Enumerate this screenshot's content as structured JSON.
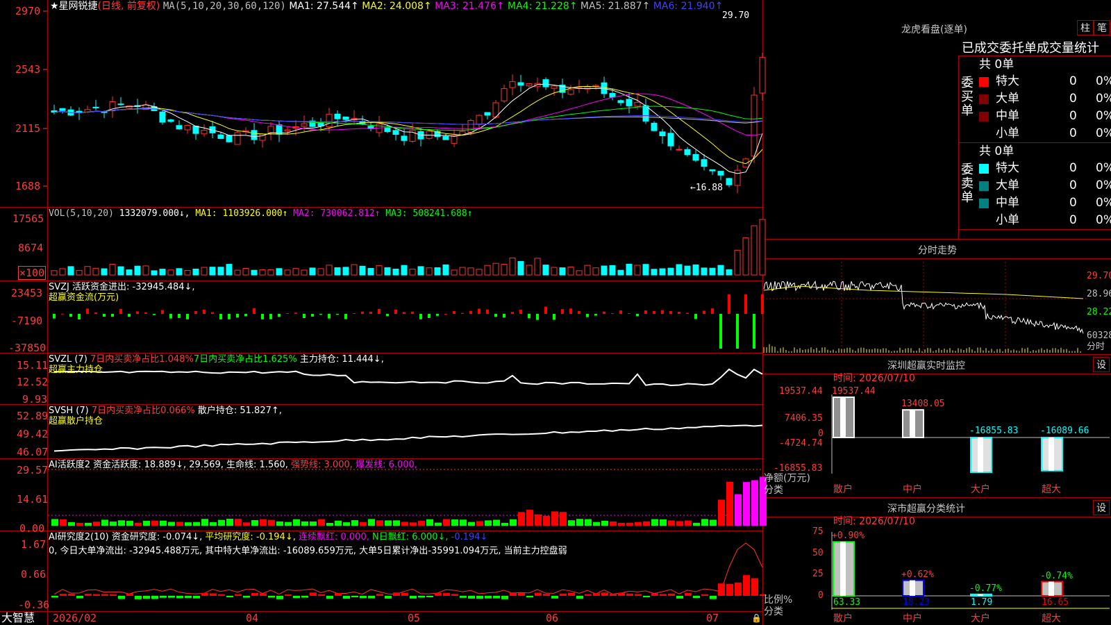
{
  "stock": {
    "star": "★",
    "name": "星网锐捷",
    "mode": "(日线, 前复权)",
    "ma_label": "MA(5,10,20,30,60,120)",
    "ma_values": [
      {
        "label": "MA1:",
        "value": "27.544↑",
        "color": "#ffffff"
      },
      {
        "label": "MA2:",
        "value": "24.008↑",
        "color": "#ffff00"
      },
      {
        "label": "MA3:",
        "value": "21.476↑",
        "color": "#ff00ff"
      },
      {
        "label": "MA4:",
        "value": "21.228↑",
        "color": "#00ff00"
      },
      {
        "label": "MA5:",
        "value": "21.887↑",
        "color": "#c0c0c0"
      },
      {
        "label": "MA6:",
        "value": "21.940↑",
        "color": "#4040ff"
      }
    ],
    "high_mark": "29.70",
    "low_mark": "16.88"
  },
  "price_axis": [
    "2970",
    "2543",
    "2115",
    "1688"
  ],
  "vol": {
    "axis": [
      "17565",
      "8674",
      "×100"
    ],
    "label": "VOL(5,10,20)",
    "value": "1332079.000↓,",
    "ma": [
      {
        "label": "MA1:",
        "value": "1103926.000↑",
        "color": "#ffff00"
      },
      {
        "label": "MA2:",
        "value": "730062.812↑",
        "color": "#ff00ff"
      },
      {
        "label": "MA3:",
        "value": "508241.688↑",
        "color": "#00ff00"
      }
    ]
  },
  "svzj": {
    "axis": [
      "23453",
      "-7190",
      "-37850"
    ],
    "line1": "SVZJ  活跃资金进出: -32945.484↓,",
    "line2": "超赢资金流(万元)"
  },
  "svzl": {
    "axis": [
      "15.11",
      "12.52",
      "9.93"
    ],
    "p1": "SVZL (7)",
    "p2": "7日内买卖净占比1.048%",
    "p3": "7日内买卖净占比1.625%",
    "p4": "主力持仓: 11.444↓,",
    "line2": "超赢主力持仓"
  },
  "svsh": {
    "axis": [
      "52.89",
      "49.42",
      "46.07"
    ],
    "p1": "SVSH (7)",
    "p2": "7日内买卖净占比0.066%",
    "p3": "散户持仓: 51.827↑,",
    "line2": "超赢散户持仓"
  },
  "ai2": {
    "axis": [
      "29.57",
      "14.61",
      "0.00"
    ],
    "p1": "AI活跃度2 资金活跃度: 18.889↓, 29.569, 生命线: 1.560,",
    "p2": "强势线: 3.000,",
    "p3": "爆发线: 6.000,"
  },
  "ai_research": {
    "axis": [
      "1.67",
      "0.66",
      "-0.36"
    ],
    "p1": "AI研究度2(10) 资金研究度: -0.074↓,",
    "p2": "平均研究度: -0.194↓,",
    "p3": "连续飘红: 0.000,",
    "p4": "N日飘红: 6.000↓,",
    "p5": "-0.194↓",
    "summary": "0, 今日大单净流出: -32945.488万元, 其中特大单净流出: -16089.659万元, 大单5日累计净出-35991.094万元, 当前主力控盘弱"
  },
  "date_axis": {
    "brand": "大智慧",
    "labels": [
      "2026/02",
      "04",
      "05",
      "06",
      "07"
    ]
  },
  "right": {
    "lhb_title": "龙虎看盘(逐单)",
    "btn_bar": "柱",
    "btn_pen": "笔",
    "order_title": "已成交委托单成交量统计",
    "buy_label": "委买单",
    "sell_label": "委卖单",
    "total": "共 0单",
    "rows": [
      {
        "name": "特大",
        "count": "0",
        "pct": "0%"
      },
      {
        "name": "大单",
        "count": "0",
        "pct": "0%"
      },
      {
        "name": "中单",
        "count": "0",
        "pct": "0%"
      },
      {
        "name": "小单",
        "count": "0",
        "pct": "0%"
      }
    ],
    "intraday_title": "分时走势",
    "intraday_axis": [
      "29.70",
      "28.96",
      "28.22",
      "60328",
      "分时"
    ],
    "monitor_title": "深圳超赢实时监控",
    "monitor_setting": "设",
    "monitor_time": "时间: 2026/07/10",
    "monitor_axis": [
      "19537.44",
      "7406.35",
      "0",
      "-4724.74",
      "-16855.83"
    ],
    "monitor_axis_title1": "净额(万元)",
    "monitor_axis_title2": "分类",
    "monitor_bars": [
      {
        "name": "散户",
        "value": "19537.44",
        "num": 19537.44
      },
      {
        "name": "中户",
        "value": "13408.05",
        "num": 13408.05
      },
      {
        "name": "大户",
        "value": "-16855.83",
        "num": -16855.83
      },
      {
        "name": "超大",
        "value": "-16089.66",
        "num": -16089.66
      }
    ],
    "class_title": "深市超赢分类统计",
    "class_setting": "设",
    "class_time": "时间: 2026/07/10",
    "class_axis": [
      "75",
      "50",
      "25",
      "0"
    ],
    "class_axis_title1": "比例%",
    "class_axis_title2": "分类",
    "class_bars": [
      {
        "name": "散户",
        "pct": 63.33,
        "label": "63.33",
        "change": "+0.90%",
        "color": "#00ff00"
      },
      {
        "name": "中户",
        "pct": 18.23,
        "label": "18.23",
        "change": "+0.62%",
        "color": "#0000ff"
      },
      {
        "name": "大户",
        "pct": 1.79,
        "label": "1.79",
        "change": "-0.77%",
        "color": "#00ffff"
      },
      {
        "name": "超大",
        "pct": 16.65,
        "label": "16.65",
        "change": "-0.74%",
        "color": "#ff0000"
      }
    ]
  }
}
